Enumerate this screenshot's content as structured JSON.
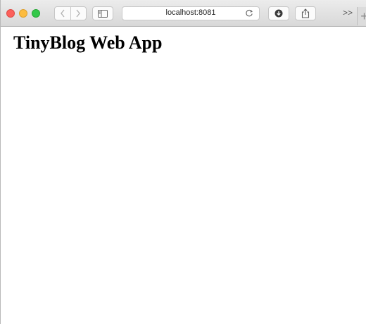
{
  "browser": {
    "url": "localhost:8081",
    "overflow_label": ">>",
    "new_tab_label": "+",
    "icons": {
      "back": "chevron-left-icon",
      "forward": "chevron-right-icon",
      "sidebar": "sidebar-icon",
      "reload": "reload-icon",
      "download": "download-icon",
      "share": "share-icon"
    }
  },
  "page": {
    "heading": "TinyBlog Web App"
  }
}
